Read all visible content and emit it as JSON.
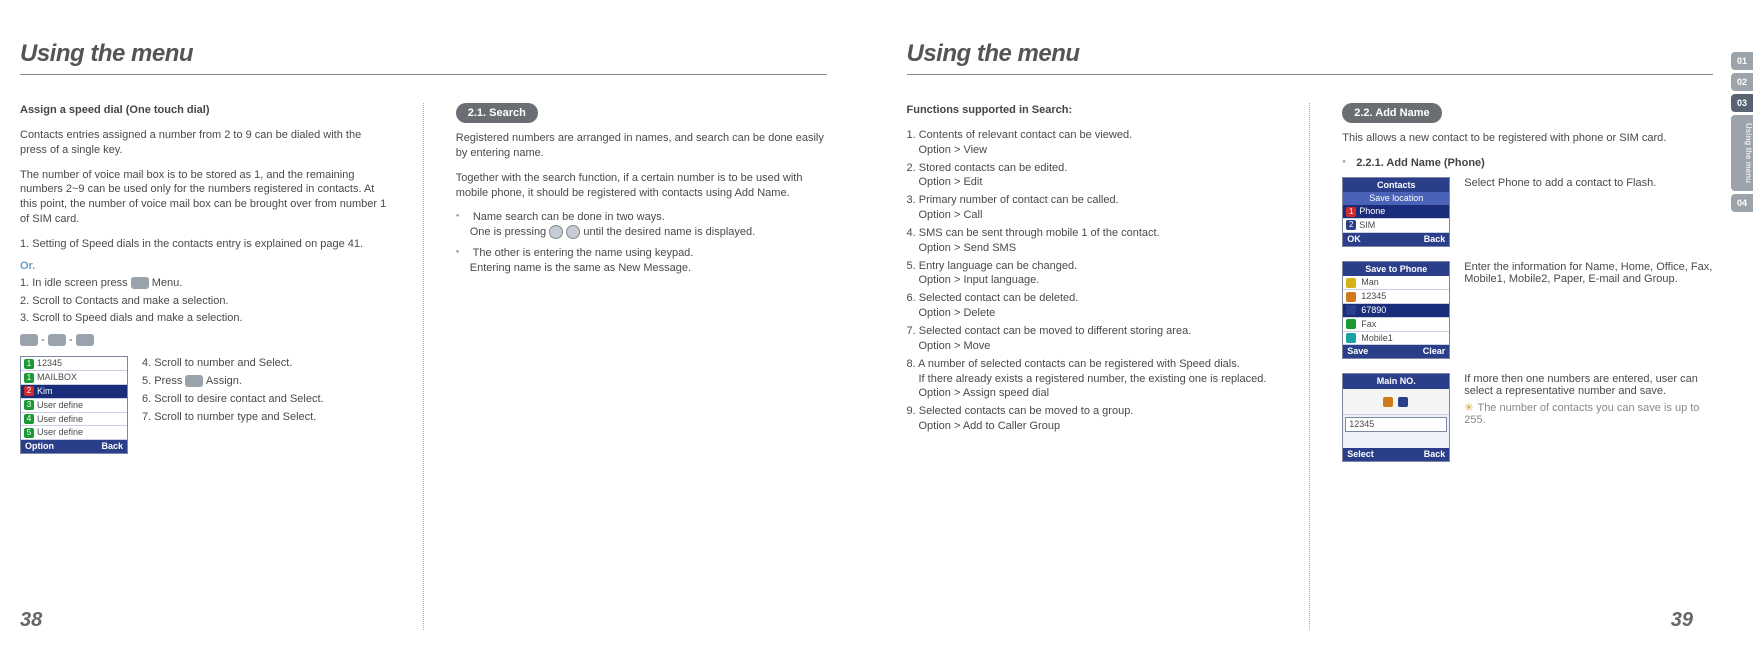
{
  "left": {
    "title": "Using the menu",
    "pageNum": "38",
    "speed": {
      "heading": "Assign a speed dial (One touch dial)",
      "p1": "Contacts entries assigned a number from 2 to 9 can be dialed with the press of a single key.",
      "p2": "The number of voice mail box is to be stored as 1, and the remaining numbers 2~9 can be used only for the numbers registered in contacts. At this point, the number of voice mail box can be brought over from number 1 of SIM card.",
      "step1": "1. Setting of Speed dials in the contacts entry is explained on page 41.",
      "or": "Or.",
      "alt1": "1. In idle screen press",
      "alt1b": "Menu.",
      "alt2": "2. Scroll to Contacts and make a selection.",
      "alt3": "3. Scroll to Speed dials and make a selection.",
      "shotList": {
        "r1": "12345",
        "r2": "MAILBOX",
        "r3": "Kim",
        "r4": "User define",
        "r5": "User define",
        "r6": "User define",
        "softL": "Option",
        "softR": "Back"
      },
      "s4": "4. Scroll to number and Select.",
      "s5a": "5. Press",
      "s5b": "Assign.",
      "s6": "6. Scroll to desire contact and Select.",
      "s7": "7. Scroll to number type and Select."
    },
    "search": {
      "header": "2.1. Search",
      "p1": "Registered numbers are arranged in names, and search can be done easily by entering name.",
      "p2": "Together with the search function, if a certain number is to be used with mobile phone, it should be registered with contacts using Add Name.",
      "b1": "Name search can be done in two ways.",
      "b1sub": "One is pressing            until the desired name is displayed.",
      "b2": "The other is entering the name using keypad.",
      "b2sub": "Entering name is the same as New Message."
    }
  },
  "right": {
    "title": "Using the menu",
    "pageNum": "39",
    "funcHeading": "Functions supported in Search:",
    "funcs": [
      {
        "t": "1. Contents of relevant contact can be viewed.",
        "o": "Option > View"
      },
      {
        "t": "2. Stored contacts can be edited.",
        "o": "Option > Edit"
      },
      {
        "t": "3. Primary number of contact can be called.",
        "o": "Option > Call"
      },
      {
        "t": "4. SMS can be sent through mobile 1 of the contact.",
        "o": "Option > Send SMS"
      },
      {
        "t": "5. Entry language can be changed.",
        "o": "Option > Input language."
      },
      {
        "t": "6. Selected contact can be deleted.",
        "o": "Option > Delete"
      },
      {
        "t": "7. Selected contact can be moved to different storing area.",
        "o": "Option > Move"
      },
      {
        "t": "8. A number of selected contacts can be registered with Speed dials.",
        "o": "If there already exists a registered number, the existing one is replaced.",
        "o2": "Option > Assign speed dial"
      },
      {
        "t": "9. Selected contacts can be moved to a group.",
        "o": "Option > Add to Caller Group"
      }
    ],
    "add": {
      "header": "2.2. Add Name",
      "intro": "This allows a new contact to be registered with phone or SIM card.",
      "sub": "2.2.1. Add Name (Phone)",
      "shot1": {
        "title": "Contacts",
        "sub": "Save location",
        "r1": "Phone",
        "r2": "SIM",
        "softL": "OK",
        "softR": "Back"
      },
      "shot1txt": "Select Phone to add a contact to Flash.",
      "shot2": {
        "title": "Save to Phone",
        "r1": "Man",
        "r2": "12345",
        "r3": "67890",
        "r4": "Fax",
        "r5": "Mobile1",
        "softL": "Save",
        "softR": "Clear"
      },
      "shot2txt": "Enter the information for Name, Home, Office, Fax, Mobile1, Mobile2, Paper, E-mail and Group.",
      "shot3": {
        "title": "Main NO.",
        "r1": "12345",
        "softL": "Select",
        "softR": "Back"
      },
      "shot3txt": "If more then one numbers are entered, user can select a representative number and save.",
      "shot3note": "The number of contacts you can save is up to 255."
    },
    "tabs": [
      "01",
      "02",
      "03",
      "04"
    ],
    "tabVert": "Using the menu"
  }
}
